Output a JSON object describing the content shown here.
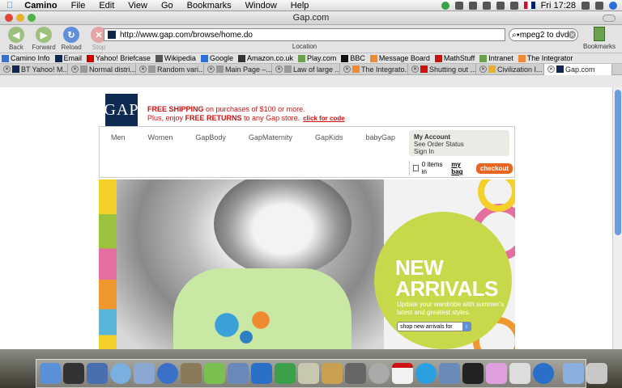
{
  "menubar": {
    "app": "Camino",
    "items": [
      "File",
      "Edit",
      "View",
      "Go",
      "Bookmarks",
      "Window",
      "Help"
    ],
    "clock": "Fri 17:28"
  },
  "window": {
    "title": "Gap.com"
  },
  "toolbar": {
    "back": "Back",
    "forward": "Forward",
    "reload": "Reload",
    "stop": "Stop",
    "url": "http://www.gap.com/browse/home.do",
    "location_label": "Location",
    "search_value": "mpeg2 to dvd",
    "bookmarks_label": "Bookmarks"
  },
  "bookmarks_bar": [
    {
      "label": "Camino Info",
      "color": "#3b6fc8"
    },
    {
      "label": "Email",
      "color": "#10264a"
    },
    {
      "label": "Yahoo! Briefcase",
      "color": "#c00"
    },
    {
      "label": "Wikipedia",
      "color": "#555"
    },
    {
      "label": "Google",
      "color": "#2a6fd6"
    },
    {
      "label": "Amazon.co.uk",
      "color": "#333"
    },
    {
      "label": "Play.com",
      "color": "#6aa14a"
    },
    {
      "label": "BBC",
      "color": "#111"
    },
    {
      "label": "Message Board",
      "color": "#f08a30"
    },
    {
      "label": "MathStuff",
      "color": "#c11"
    },
    {
      "label": "Intranet",
      "color": "#6aa14a"
    },
    {
      "label": "The Integrator",
      "color": "#f08a30"
    }
  ],
  "tabs": [
    {
      "label": "BT Yahoo! M...",
      "active": false
    },
    {
      "label": "Normal distri...",
      "active": false
    },
    {
      "label": "Random vari...",
      "active": false
    },
    {
      "label": "Main Page –...",
      "active": false
    },
    {
      "label": "Law of large ...",
      "active": false
    },
    {
      "label": "The Integrato...",
      "active": false
    },
    {
      "label": "Shutting out ...",
      "active": false
    },
    {
      "label": "Civilization I...",
      "active": false
    },
    {
      "label": "Gap.com",
      "active": true
    }
  ],
  "page": {
    "logo": "GAP",
    "promo_line1_bold": "FREE SHIPPING",
    "promo_line1_rest": " on purchases of $100 or more.",
    "promo_line2_pre": "Plus, enjoy ",
    "promo_line2_bold": "FREE RETURNS",
    "promo_line2_rest": " to any Gap store.",
    "promo_link": "click for code",
    "nav": [
      "Men",
      "Women",
      "GapBody",
      "GapMaternity",
      "GapKids",
      "babyGap"
    ],
    "account_title": "My Account",
    "account_links": [
      "See Order Status",
      "Sign In"
    ],
    "bag_pre": "0 items in",
    "bag_link": "my bag",
    "checkout": "checkout",
    "hero_title_1": "NEW",
    "hero_title_2": "ARRIVALS",
    "hero_sub": "Update your wardrobe with summer's latest and greatest styles.",
    "hero_select": "shop new arrivals for"
  }
}
